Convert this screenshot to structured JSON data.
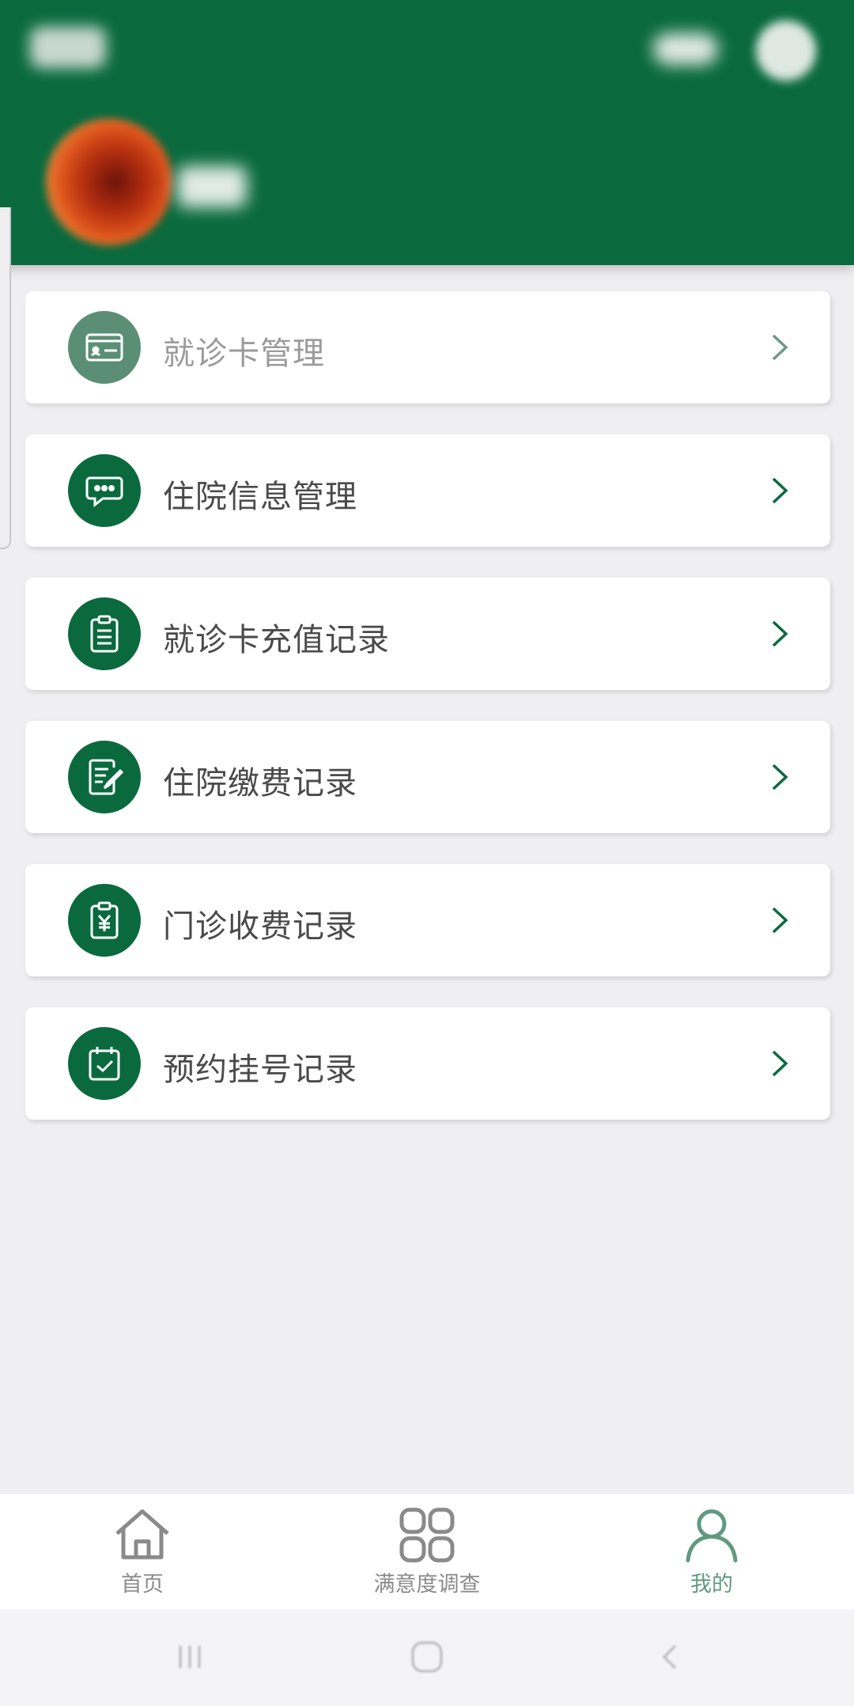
{
  "colors": {
    "brand": "#0a6a3e",
    "brand_faded": "#5a8f76",
    "active_tab": "#5f9a80",
    "inactive_tab": "#8a8a8a",
    "background": "#efeef1"
  },
  "header": {
    "icons": [
      "blurred-title",
      "eye-icon",
      "avatar-circle-icon",
      "profile-avatar"
    ]
  },
  "menu": {
    "items": [
      {
        "label": "就诊卡管理",
        "icon": "id-card-icon"
      },
      {
        "label": "住院信息管理",
        "icon": "chat-bubble-icon"
      },
      {
        "label": "就诊卡充值记录",
        "icon": "clipboard-list-icon"
      },
      {
        "label": "住院缴费记录",
        "icon": "document-edit-icon"
      },
      {
        "label": "门诊收费记录",
        "icon": "yen-clipboard-icon"
      },
      {
        "label": "预约挂号记录",
        "icon": "calendar-check-icon"
      }
    ]
  },
  "tabbar": {
    "tabs": [
      {
        "label": "首页",
        "icon": "home-icon",
        "active": false
      },
      {
        "label": "满意度调查",
        "icon": "grid-icon",
        "active": false
      },
      {
        "label": "我的",
        "icon": "person-icon",
        "active": true
      }
    ]
  },
  "system_nav": {
    "icons": [
      "recents-icon",
      "home-button-icon",
      "back-icon"
    ]
  }
}
